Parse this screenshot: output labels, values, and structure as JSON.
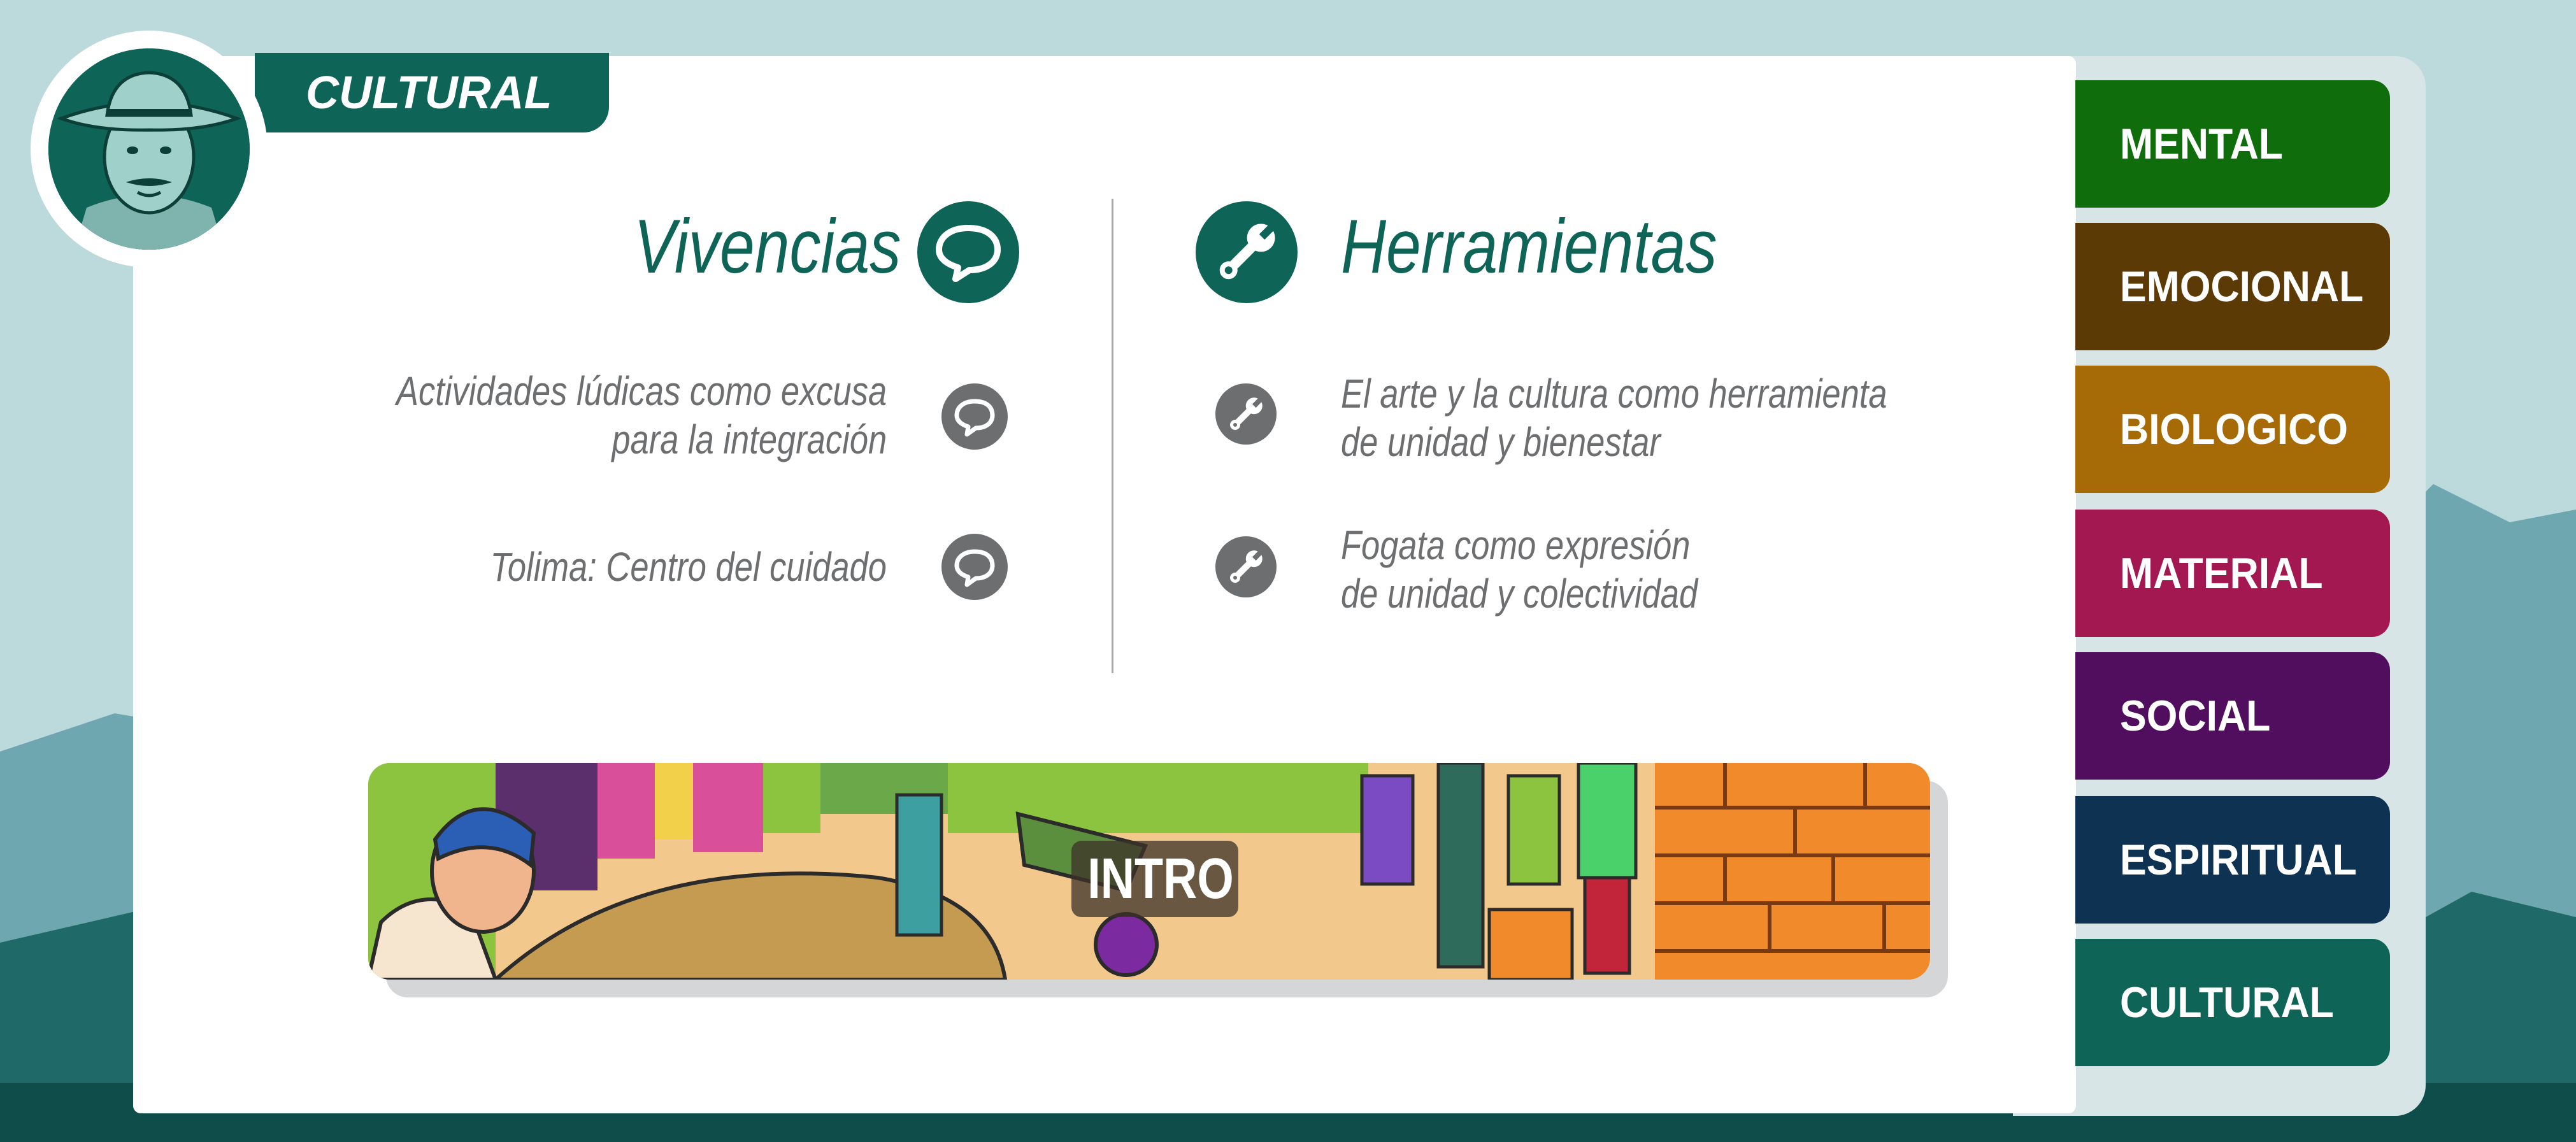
{
  "badge": {
    "label": "CULTURAL"
  },
  "vivencias": {
    "title": "Vivencias",
    "items": [
      {
        "line1": "Actividades lúdicas como excusa",
        "line2": "para la integración"
      },
      {
        "line1": "Tolima: Centro del cuidado",
        "line2": ""
      }
    ]
  },
  "herramientas": {
    "title": "Herramientas",
    "items": [
      {
        "line1": "El arte y la cultura como herramienta",
        "line2": "de unidad y bienestar"
      },
      {
        "line1": "Fogata como expresión",
        "line2": "de unidad y colectividad"
      }
    ]
  },
  "intro": {
    "label": "INTRO"
  },
  "sidebar": {
    "items": [
      {
        "label": "MENTAL",
        "color": "#0f6d0b"
      },
      {
        "label": "EMOCIONAL",
        "color": "#5c3a05"
      },
      {
        "label": "BIOLOGICO",
        "color": "#a66a07"
      },
      {
        "label": "MATERIAL",
        "color": "#a31850"
      },
      {
        "label": "SOCIAL",
        "color": "#520e5e"
      },
      {
        "label": "ESPIRITUAL",
        "color": "#0e3252"
      },
      {
        "label": "CULTURAL",
        "color": "#0f6458"
      }
    ]
  },
  "colors": {
    "primary": "#0f6458",
    "text_gray": "#6d6e70",
    "background": "#bcd9dc"
  },
  "icons": {
    "vivencias": "chat-bubble-icon",
    "herramientas": "wrench-icon"
  }
}
